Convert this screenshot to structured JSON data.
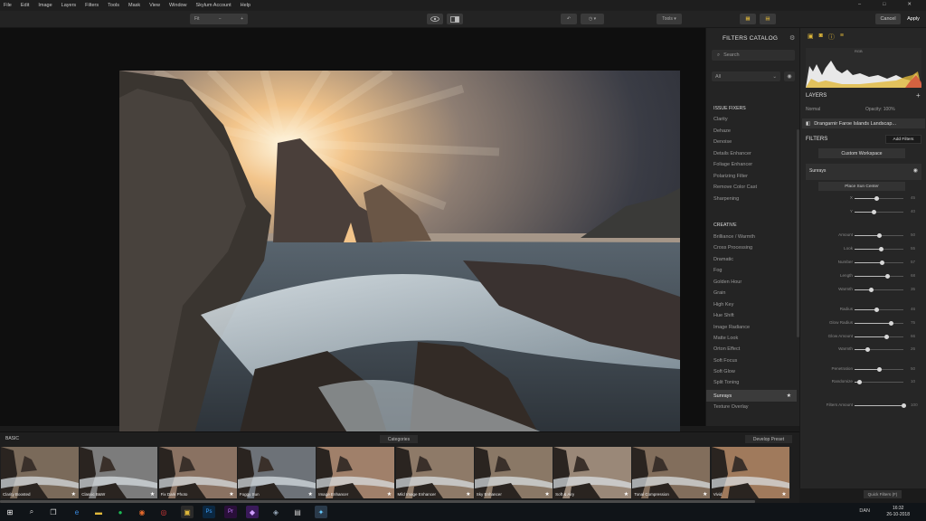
{
  "menu": [
    "File",
    "Edit",
    "Image",
    "Layers",
    "Filters",
    "Tools",
    "Mask",
    "View",
    "Window",
    "Skylum Account",
    "Help"
  ],
  "window_controls": {
    "minimize": "–",
    "maximize": "□",
    "close": "✕"
  },
  "toolbar": {
    "zoom_label": "Fit",
    "tools_label": "Tools",
    "cancel_label": "Cancel",
    "apply_label": "Apply"
  },
  "catalog": {
    "title": "FILTERS CATALOG",
    "search_placeholder": "Search",
    "filter_select": "All",
    "sections": [
      {
        "name": "ISSUE FIXERS",
        "items": [
          "Clarity",
          "Dehaze",
          "Denoise",
          "Details Enhancer",
          "Foliage Enhancer",
          "Polarizing Filter",
          "Remove Color Cast",
          "Sharpening"
        ]
      },
      {
        "name": "CREATIVE",
        "items": [
          "Brilliance / Warmth",
          "Cross Processing",
          "Dramatic",
          "Fog",
          "Golden Hour",
          "Grain",
          "High Key",
          "Hue Shift",
          "Image Radiance",
          "Matte Look",
          "Orton Effect",
          "Soft Focus",
          "Soft Glow",
          "Split Toning",
          "Sunrays",
          "Texture Overlay"
        ]
      }
    ],
    "selected_item": "Sunrays"
  },
  "right_panel": {
    "histogram_label": "RGB",
    "layers_title": "LAYERS",
    "blend_mode": "Normal",
    "opacity": "Opacity: 100%",
    "layer_name": "Drangarnir Faroe Islands Landscap...",
    "filters_title": "FILTERS",
    "add_filters": "Add Filters",
    "workspace": "Custom Workspace",
    "filter_name": "Sunrays",
    "place_sun": "Place Sun Center",
    "sliders": [
      {
        "label": "X",
        "value": 0.45,
        "display": "45"
      },
      {
        "label": "Y",
        "value": 0.4,
        "display": "40"
      },
      {
        "label": "Amount",
        "value": 0.5,
        "display": "50"
      },
      {
        "label": "Look",
        "value": 0.55,
        "display": "55"
      },
      {
        "label": "Number",
        "value": 0.57,
        "display": "57"
      },
      {
        "label": "Length",
        "value": 0.68,
        "display": "68"
      },
      {
        "label": "Warmth",
        "value": 0.35,
        "display": "35"
      },
      {
        "label": "Radius",
        "value": 0.46,
        "display": "46"
      },
      {
        "label": "Glow Radius",
        "value": 0.75,
        "display": "75"
      },
      {
        "label": "Glow Amount",
        "value": 0.66,
        "display": "66"
      },
      {
        "label": "Warmth",
        "value": 0.26,
        "display": "26"
      },
      {
        "label": "Penetration",
        "value": 0.5,
        "display": "50"
      },
      {
        "label": "Randomize",
        "value": 0.1,
        "display": "10"
      },
      {
        "label": "Filters Amount",
        "value": 1.0,
        "display": "100"
      }
    ],
    "quick_presets": "Quick Filters (F)"
  },
  "filmstrip": {
    "section": "BASIC",
    "categories_btn": "Categories",
    "develop_btn": "Develop Preset",
    "presets": [
      "Clarity Boosted",
      "Classic B&W",
      "Fix Dark Photo",
      "Foggy Sun",
      "Image Enhancer",
      "Mild Image Enhancer",
      "Sky Enhancer",
      "Soft & Airy",
      "Tonal Compression",
      "Vivid"
    ]
  },
  "taskbar": {
    "time": "16:32",
    "date": "26-10-2018",
    "lang": "DAN"
  },
  "colors": {
    "accent": "#e0b83a",
    "panel": "#242424",
    "canvas": "#0f0f0f"
  }
}
